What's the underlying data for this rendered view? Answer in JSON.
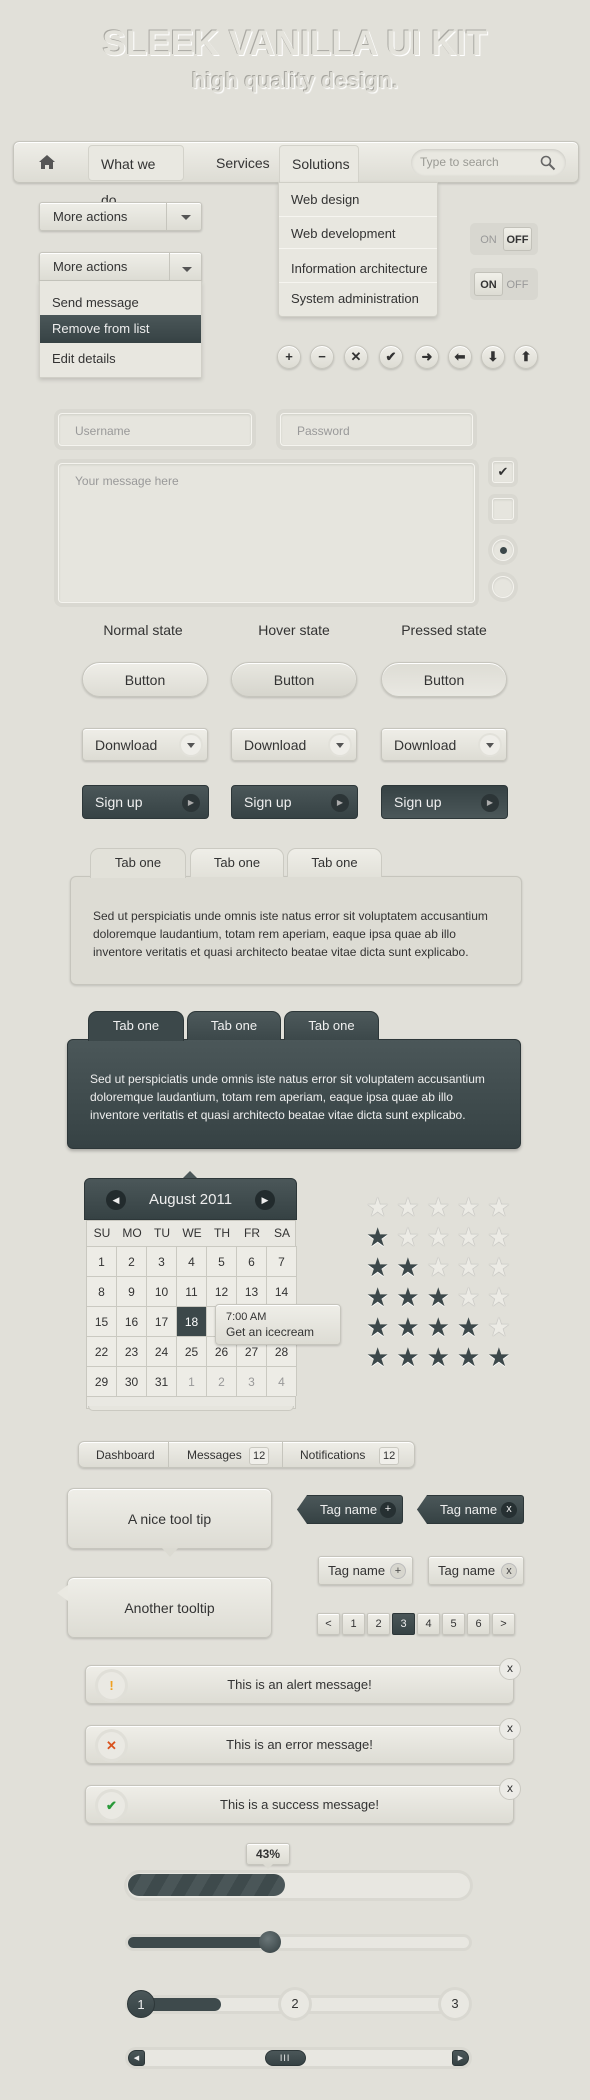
{
  "header": {
    "title": "SLEEK VANILLA UI KIT",
    "subtitle": "high quality design."
  },
  "nav": {
    "items": [
      "What we do",
      "Services",
      "Solutions"
    ],
    "search_placeholder": "Type to search",
    "dropdown": [
      "Web design",
      "Web development",
      "Information architecture",
      "System administration"
    ]
  },
  "select1": {
    "label": "More actions"
  },
  "select2": {
    "label": "More actions",
    "options": [
      "Send message",
      "Remove from list",
      "Edit details"
    ],
    "highlighted": "Remove from list"
  },
  "toggles": [
    {
      "on": "ON",
      "off": "OFF",
      "state": "off"
    },
    {
      "on": "ON",
      "off": "OFF",
      "state": "on"
    }
  ],
  "icon_buttons": [
    "plus-icon",
    "minus-icon",
    "close-icon",
    "check-icon",
    "arrow-right-icon",
    "arrow-left-icon",
    "arrow-down-icon",
    "arrow-up-icon"
  ],
  "form": {
    "username_placeholder": "Username",
    "password_placeholder": "Password",
    "message_placeholder": "Your message here",
    "checkbox1_checked": true,
    "checkbox2_checked": false,
    "radio1_checked": true,
    "radio2_checked": false
  },
  "states": [
    "Normal state",
    "Hover state",
    "Pressed state"
  ],
  "buttons": {
    "button": "Button",
    "download": [
      "Donwload",
      "Download",
      "Download"
    ],
    "signup": "Sign up"
  },
  "tabs_light": {
    "tabs": [
      "Tab one",
      "Tab one",
      "Tab one"
    ],
    "content": "Sed ut perspiciatis unde omnis iste natus error sit voluptatem accusantium doloremque laudantium, totam rem aperiam, eaque ipsa quae ab illo inventore veritatis et quasi architecto beatae vitae dicta sunt explicabo."
  },
  "tabs_dark": {
    "tabs": [
      "Tab one",
      "Tab one",
      "Tab one"
    ],
    "content": "Sed ut perspiciatis unde omnis iste natus error sit voluptatem accusantium doloremque laudantium, totam rem aperiam, eaque ipsa quae ab illo inventore veritatis et quasi architecto beatae vitae dicta sunt explicabo."
  },
  "calendar": {
    "month": "August 2011",
    "days": [
      "SU",
      "MO",
      "TU",
      "WE",
      "TH",
      "FR",
      "SA"
    ],
    "weeks": [
      [
        "1",
        "2",
        "3",
        "4",
        "5",
        "6",
        "7"
      ],
      [
        "8",
        "9",
        "10",
        "11",
        "12",
        "13",
        "14"
      ],
      [
        "15",
        "16",
        "17",
        "18",
        "19",
        "20",
        "21"
      ],
      [
        "22",
        "23",
        "24",
        "25",
        "26",
        "27",
        "28"
      ],
      [
        "29",
        "30",
        "31",
        "1",
        "2",
        "3",
        "4"
      ]
    ],
    "selected": "18",
    "event": {
      "time": "7:00 AM",
      "text": "Get an icecream"
    }
  },
  "ratings": [
    0,
    1,
    2,
    3,
    4,
    5
  ],
  "tabbar": {
    "items": [
      {
        "label": "Dashboard"
      },
      {
        "label": "Messages",
        "badge": "12"
      },
      {
        "label": "Notifications",
        "badge": "12"
      }
    ]
  },
  "tooltips": [
    "A nice tool tip",
    "Another tooltip"
  ],
  "tags": {
    "dark": [
      {
        "label": "Tag name",
        "action": "+"
      },
      {
        "label": "Tag name",
        "action": "x"
      }
    ],
    "light": [
      {
        "label": "Tag name",
        "action": "+"
      },
      {
        "label": "Tag name",
        "action": "x"
      }
    ]
  },
  "pagination": {
    "items": [
      "<",
      "1",
      "2",
      "3",
      "4",
      "5",
      "6",
      ">"
    ],
    "current": "3"
  },
  "alerts": [
    {
      "text": "This is an alert message!",
      "icon": "!",
      "color": "#f0a020"
    },
    {
      "text": "This is an error message!",
      "icon": "✕",
      "color": "#d9531e"
    },
    {
      "text": "This is a success message!",
      "icon": "✔",
      "color": "#2a9a3a"
    }
  ],
  "alert_close": "x",
  "progress": {
    "value": 43,
    "label": "43%"
  },
  "slider": {
    "value": 40
  },
  "steps": {
    "items": [
      "1",
      "2",
      "3"
    ],
    "current": 1
  },
  "scrollbar": {
    "position": 45
  },
  "colors": {
    "accent": "#3c484a",
    "background": "#e1e0d9"
  }
}
